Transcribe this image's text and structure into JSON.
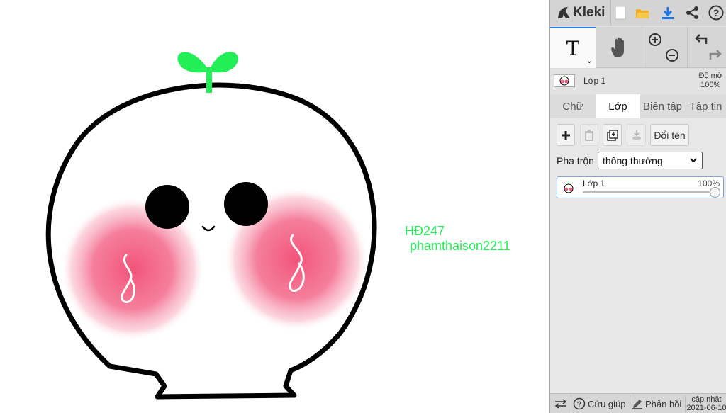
{
  "app": {
    "name": "Kleki"
  },
  "canvas": {
    "text_lines": [
      "HĐ247",
      "phamthaison2211"
    ],
    "text_color": "#22ee55"
  },
  "topbar": {
    "icons": [
      "new-file-icon",
      "open-folder-icon",
      "download-icon",
      "share-icon",
      "help-icon"
    ]
  },
  "tools": {
    "text_tool_glyph": "T",
    "icons": [
      "hand-icon",
      "zoom-in-icon",
      "zoom-out-icon",
      "undo-icon",
      "redo-icon"
    ]
  },
  "layer_preview": {
    "name": "Lớp 1",
    "opacity_label": "Độ mờ",
    "opacity_value": "100%"
  },
  "tabs": [
    {
      "label": "Chữ",
      "active": false
    },
    {
      "label": "Lớp",
      "active": true
    },
    {
      "label": "Biên tập",
      "active": false
    },
    {
      "label": "Tập tin",
      "active": false
    }
  ],
  "layers_panel": {
    "rename_label": "Đổi tên",
    "blend_label": "Pha trộn",
    "blend_value": "thông thường",
    "layers": [
      {
        "name": "Lớp 1",
        "opacity": "100%",
        "opacity_fraction": 1.0
      }
    ]
  },
  "bottombar": {
    "help_label": "Cứu giúp",
    "feedback_label": "Phản hồi",
    "update_label": "cập nhật",
    "update_date": "2021-06-10"
  },
  "colors": {
    "accent": "#2a7fe0",
    "sprout": "#22ee55",
    "blush": "#f25a7e"
  }
}
